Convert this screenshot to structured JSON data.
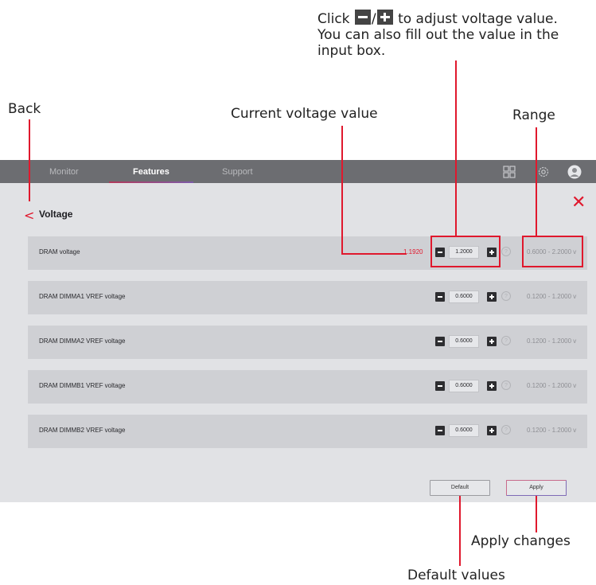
{
  "callouts": {
    "instruction_click": "Click",
    "instruction_after_icons": "to adjust voltage value.",
    "instruction_line2": "You can also fill out the value in the",
    "instruction_line3": "input box.",
    "back": "Back",
    "current_voltage": "Current voltage value",
    "range": "Range",
    "apply_changes": "Apply changes",
    "default_values": "Default values"
  },
  "nav": {
    "tabs": [
      {
        "label": "Monitor"
      },
      {
        "label": "Features"
      },
      {
        "label": "Support"
      }
    ],
    "active_tab": "Features"
  },
  "page": {
    "title": "Voltage"
  },
  "rows": [
    {
      "label": "DRAM voltage",
      "current": "1.1920",
      "value": "1.2000",
      "range": "0.6000 - 2.2000 v"
    },
    {
      "label": "DRAM DIMMA1 VREF voltage",
      "current": "",
      "value": "0.6000",
      "range": "0.1200 - 1.2000 v"
    },
    {
      "label": "DRAM DIMMA2 VREF voltage",
      "current": "",
      "value": "0.6000",
      "range": "0.1200 - 1.2000 v"
    },
    {
      "label": "DRAM DIMMB1 VREF voltage",
      "current": "",
      "value": "0.6000",
      "range": "0.1200 - 1.2000 v"
    },
    {
      "label": "DRAM DIMMB2 VREF voltage",
      "current": "",
      "value": "0.6000",
      "range": "0.1200 - 1.2000 v"
    }
  ],
  "footer": {
    "default_label": "Default",
    "apply_label": "Apply"
  },
  "colors": {
    "accent_red": "#e0182d",
    "navbar": "#6c6d71",
    "panel": "#e1e2e5",
    "row": "#cfd0d4"
  }
}
